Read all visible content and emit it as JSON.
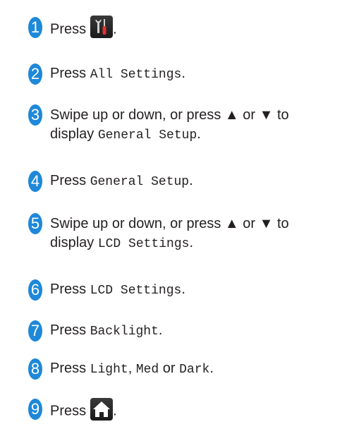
{
  "steps": [
    {
      "number": "1",
      "press": "Press",
      "end": "."
    },
    {
      "number": "2",
      "press": "Press",
      "code": "All Settings",
      "end": "."
    },
    {
      "number": "3",
      "line1": "Swipe up or down, or press ▲ or ▼ to",
      "display": "display",
      "code": "General Setup",
      "end": "."
    },
    {
      "number": "4",
      "press": "Press",
      "code": "General Setup",
      "end": "."
    },
    {
      "number": "5",
      "line1": "Swipe up or down, or press ▲ or ▼ to",
      "display": "display",
      "code": "LCD Settings",
      "end": "."
    },
    {
      "number": "6",
      "press": "Press",
      "code": "LCD Settings",
      "end": "."
    },
    {
      "number": "7",
      "press": "Press",
      "code": "Backlight",
      "end": "."
    },
    {
      "number": "8",
      "press": "Press",
      "code1": "Light",
      "sep": ",",
      "code2": "Med",
      "or": "or",
      "code3": "Dark",
      "end": "."
    },
    {
      "number": "9",
      "press": "Press",
      "end": "."
    }
  ],
  "icons": {
    "settings": "settings-tools-icon",
    "home": "home-icon"
  },
  "colors": {
    "badge": "#1e88d9",
    "text": "#231f20",
    "button": "#2a2a2a"
  }
}
